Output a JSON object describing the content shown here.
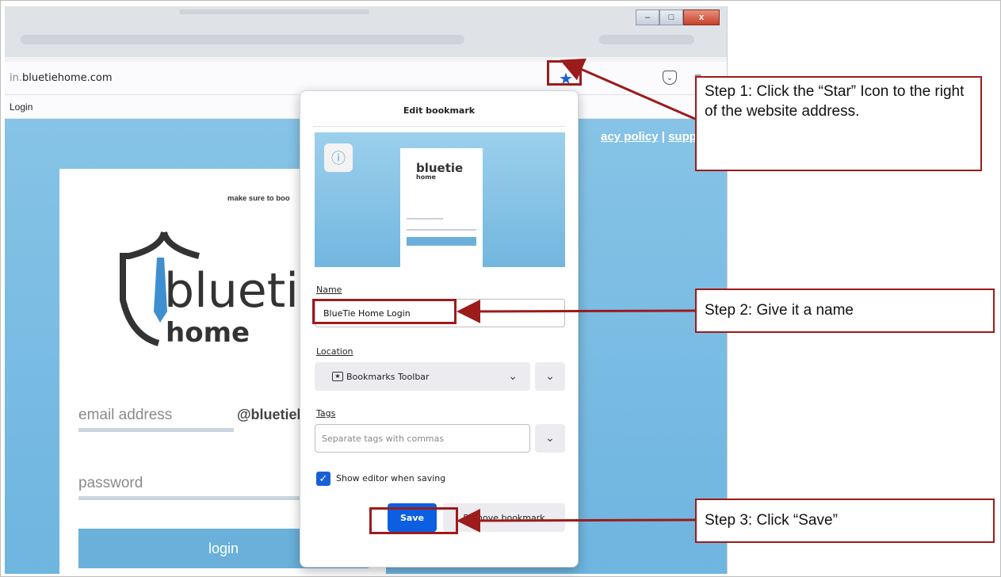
{
  "browser": {
    "url_prefix": "in.",
    "url_domain": "bluetiehome.com",
    "bookmarks_bar_item": "Login",
    "icons": {
      "star": "bookmark-star-icon",
      "pocket": "pocket-icon",
      "menu": "hamburger-menu-icon"
    },
    "window_buttons": [
      "minimize",
      "maximize",
      "close"
    ]
  },
  "page": {
    "top_links": {
      "privacy": "acy policy",
      "separator": "|",
      "support": "supp"
    },
    "bookmark_hint": "make sure to boo",
    "logo_text_main": "bluetie",
    "logo_text_sub": "home",
    "email_placeholder": "email address",
    "email_domain": "@bluetieh",
    "password_placeholder": "password",
    "login_button": "login",
    "colors": {
      "background": "#7ab9e2",
      "accent": "#6ab0da"
    }
  },
  "popup": {
    "title": "Edit bookmark",
    "preview": {
      "logo_main": "bluetie",
      "logo_sub": "home"
    },
    "name_label": "Name",
    "name_value": "BlueTie Home Login",
    "location_label": "Location",
    "location_value": "Bookmarks Toolbar",
    "tags_label": "Tags",
    "tags_placeholder": "Separate tags with commas",
    "show_editor_label": "Show editor when saving",
    "show_editor_checked": true,
    "save_button": "Save",
    "remove_button": "Remove bookmark",
    "colors": {
      "primary": "#0b5fe0"
    }
  },
  "annotations": {
    "step1": "Step 1: Click the “Star” Icon to the right of the website address.",
    "step2": "Step 2: Give it a name",
    "step3": "Step 3: Click “Save”",
    "color": "#9c1b1b"
  }
}
